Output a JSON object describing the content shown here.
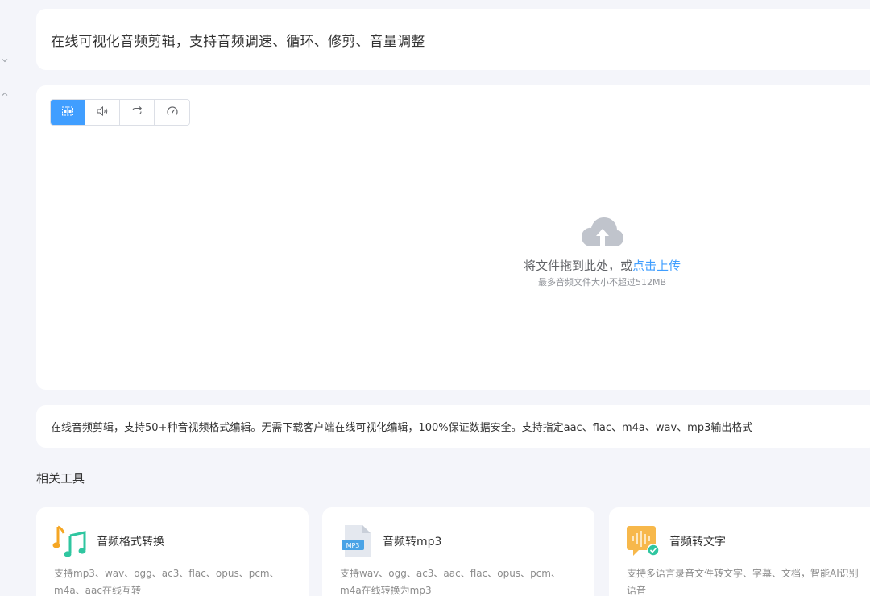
{
  "header": {
    "title": "在线可视化音频剪辑，支持音频调速、循环、修剪、音量调整"
  },
  "toolbar": {
    "buttons": [
      {
        "icon": "trim-icon",
        "active": true
      },
      {
        "icon": "volume-icon",
        "active": false
      },
      {
        "icon": "loop-icon",
        "active": false
      },
      {
        "icon": "speed-icon",
        "active": false
      }
    ]
  },
  "upload": {
    "icon": "cloud-upload-icon",
    "prompt": "将文件拖到此处，或",
    "link_label": "点击上传",
    "tip": "最多音频文件大小不超过512MB"
  },
  "description": "在线音频剪辑，支持50+种音视频格式编辑。无需下载客户端在线可视化编辑，100%保证数据安全。支持指定aac、flac、m4a、wav、mp3输出格式",
  "related": {
    "title": "相关工具",
    "tools": [
      {
        "name": "音频格式转换",
        "description": "支持mp3、wav、ogg、ac3、flac、opus、pcm、m4a、aac在线互转",
        "icon": "music-notes-icon"
      },
      {
        "name": "音频转mp3",
        "description": "支持wav、ogg、ac3、aac、flac、opus、pcm、m4a在线转换为mp3",
        "icon": "mp3-file-icon"
      },
      {
        "name": "音频转文字",
        "description": "支持多语言录音文件转文字、字幕、文档，智能AI识别语音",
        "icon": "audio-to-text-icon"
      }
    ]
  },
  "colors": {
    "accent": "#409eff",
    "background": "#f4f5fa",
    "card": "#ffffff"
  }
}
